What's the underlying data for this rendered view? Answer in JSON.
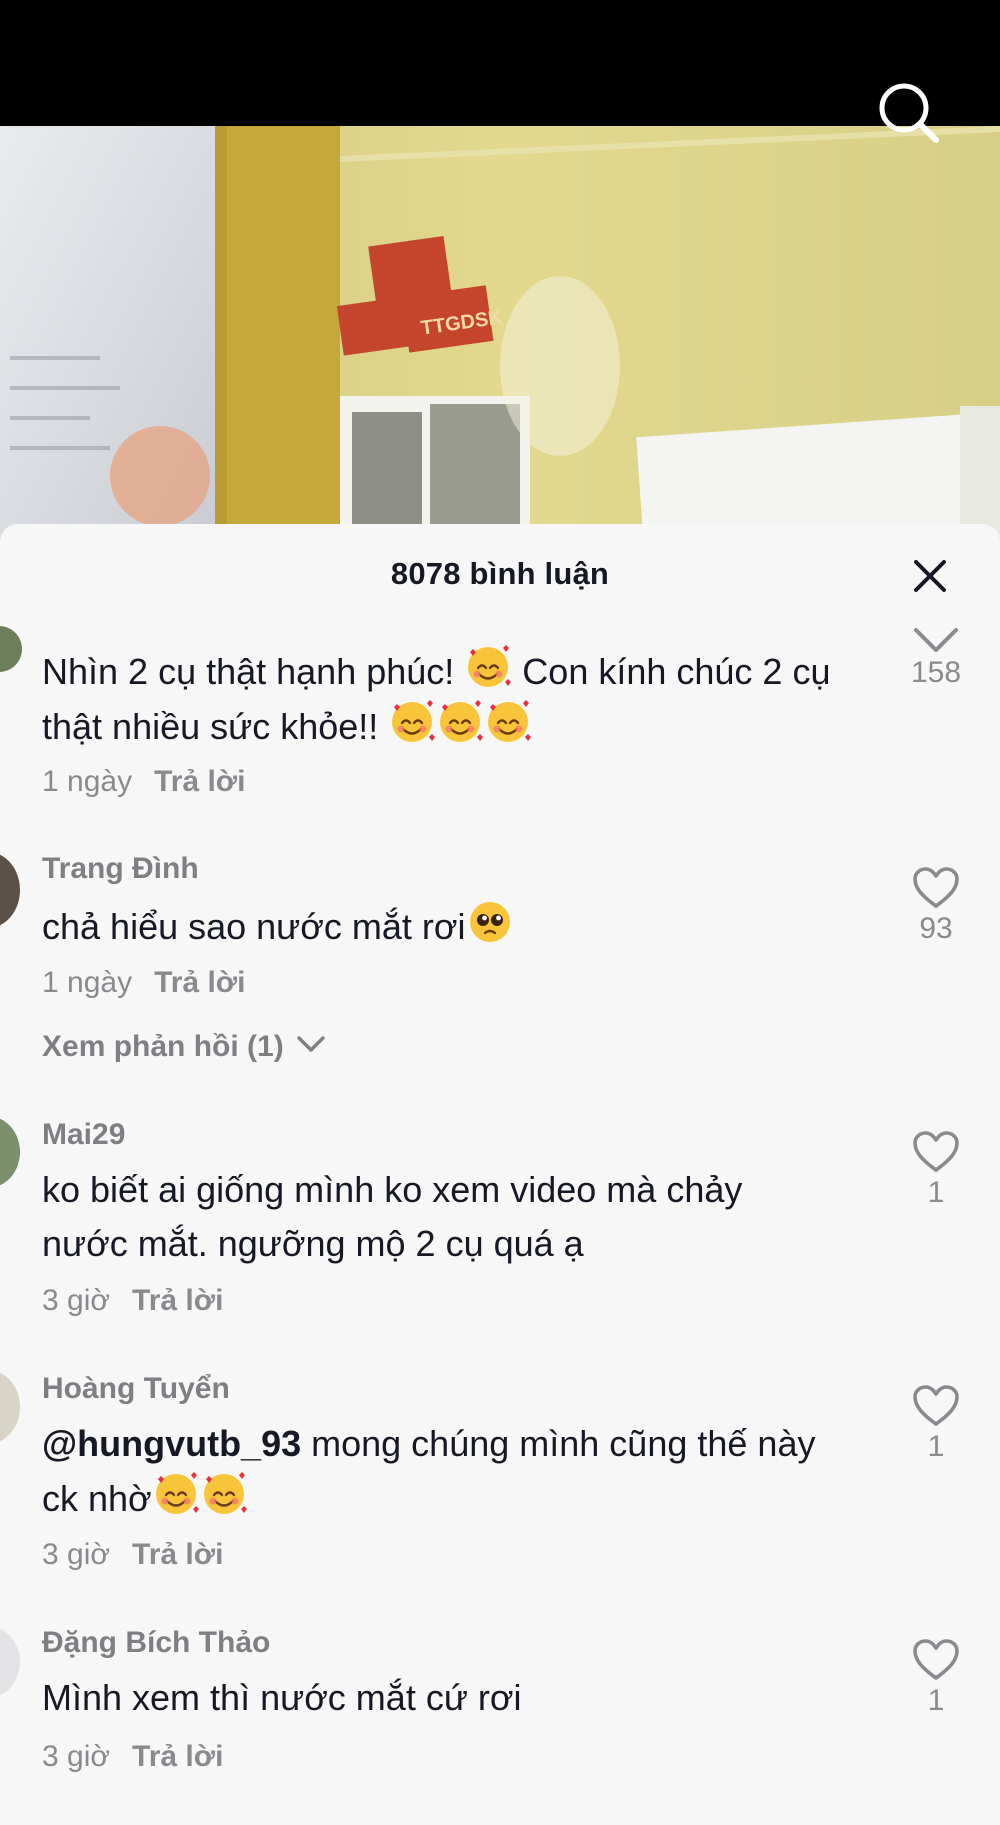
{
  "header": {
    "comment_count_title": "8078 bình luận"
  },
  "comments": [
    {
      "text_before": "Nhìn 2 cụ thật hạnh phúc! ",
      "text_after": " Con kính chúc 2 cụ thật nhiều sức khỏe!! ",
      "time": "1 ngày",
      "reply_label": "Trả lời",
      "likes": "158"
    },
    {
      "username": "Trang Đình",
      "text": "chả hiểu sao nước mắt rơi",
      "time": "1 ngày",
      "reply_label": "Trả lời",
      "likes": "93",
      "view_replies": "Xem phản hồi (1)"
    },
    {
      "username": "Mai29",
      "text": "ko biết ai giống mình ko xem video mà chảy nước mắt. ngưỡng mộ 2 cụ quá ạ",
      "time": "3 giờ",
      "reply_label": "Trả lời",
      "likes": "1"
    },
    {
      "username": "Hoàng Tuyển",
      "mention": "@hungvutb_93",
      "text": " mong chúng mình cũng thế này ck nhờ",
      "time": "3 giờ",
      "reply_label": "Trả lời",
      "likes": "1"
    },
    {
      "username": "Đặng Bích Thảo",
      "text": "Mình xem thì nước mắt cứ rơi",
      "time": "3 giờ",
      "reply_label": "Trả lời",
      "likes": "1"
    }
  ],
  "icons": {
    "search": "search-icon",
    "close": "close-icon",
    "like": "heart-icon",
    "collapse": "chevron-down-icon",
    "smiling_face_hearts": "smiling-face-with-hearts-emoji",
    "pleading_face": "pleading-face-emoji"
  },
  "colors": {
    "sheet_bg": "#f7f7f8",
    "primary_text": "#161823",
    "secondary_text": "#8a8a8e"
  }
}
